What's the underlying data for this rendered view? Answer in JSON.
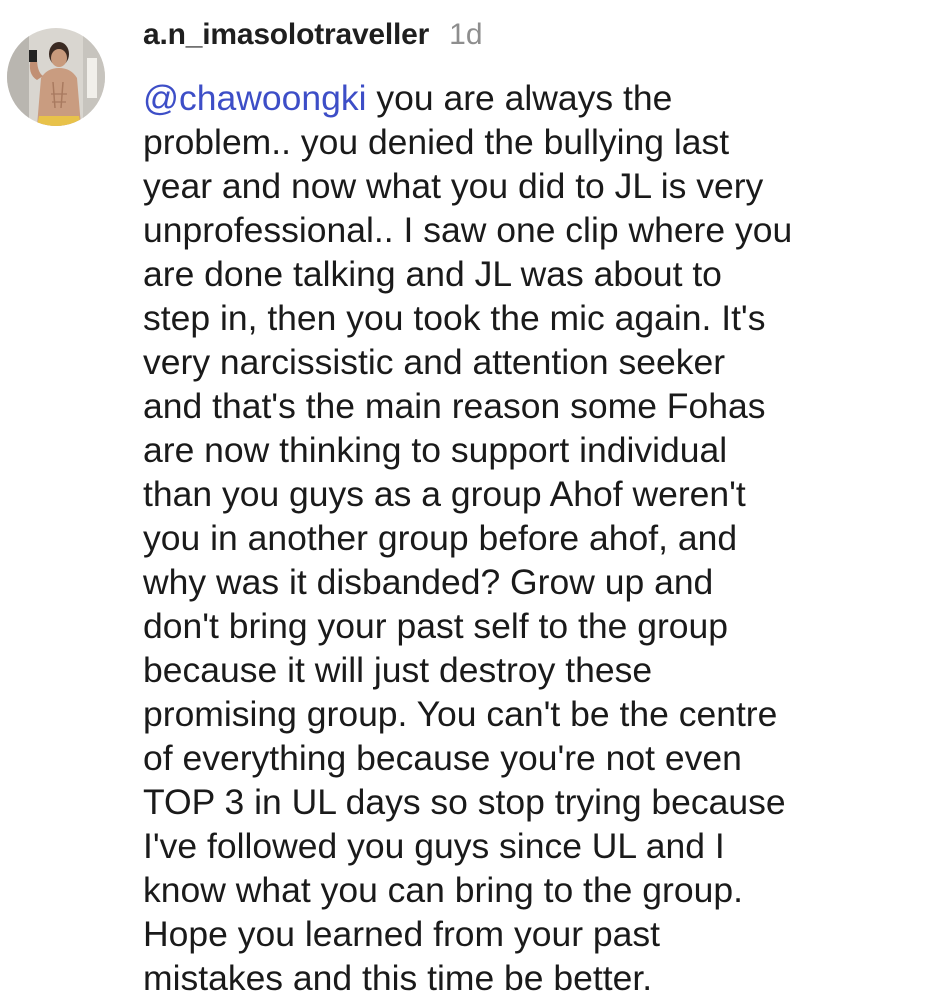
{
  "comment": {
    "username": "a.n_imasolotraveller",
    "timestamp": "1d",
    "mention": "@chawoongki",
    "first_line_rest": " you are always the",
    "lines": [
      "problem.. you denied the bullying last",
      "year and now what you did to JL is very",
      "unprofessional.. I saw one clip where you",
      "are done talking and JL was about to",
      "step in, then you took the mic again. It's",
      "very narcissistic and attention seeker",
      "and that's the main reason some Fohas",
      "are now thinking to support individual",
      "than you guys as a group Ahof weren't",
      "you in another group before ahof, and",
      "why was it disbanded? Grow up and",
      "don't bring your past self to the group",
      "because it will just destroy these",
      "promising group. You can't be the centre",
      "of everything because you're not even",
      "TOP 3 in UL days so stop trying because",
      "I've followed you guys since UL and I",
      "know what you can bring to the group.",
      "Hope you learned from your past",
      "mistakes and this time be better."
    ]
  },
  "colors": {
    "mention": "#3d4ec7",
    "timestamp": "#8e8e8e",
    "text": "#1a1a1a"
  }
}
